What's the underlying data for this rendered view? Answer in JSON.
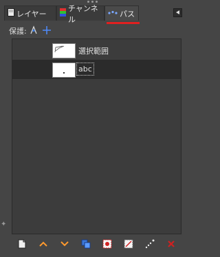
{
  "tabs": [
    {
      "label": "レイヤー",
      "icon": "layers-icon",
      "active": false
    },
    {
      "label": "チャンネル",
      "icon": "channels-icon",
      "active": false
    },
    {
      "label": "パス",
      "icon": "paths-icon",
      "active": true
    }
  ],
  "lock": {
    "label": "保護:"
  },
  "paths": [
    {
      "name": "選択範囲",
      "selected": false
    },
    {
      "name": "abc",
      "selected": true
    }
  ],
  "toolbar": {
    "buttons": [
      "new-path-icon",
      "raise-path-icon",
      "lower-path-icon",
      "duplicate-path-icon",
      "path-to-selection-icon",
      "selection-to-path-icon",
      "paint-along-path-icon",
      "delete-path-icon"
    ]
  },
  "colors": {
    "accent_underline": "#e02020"
  }
}
